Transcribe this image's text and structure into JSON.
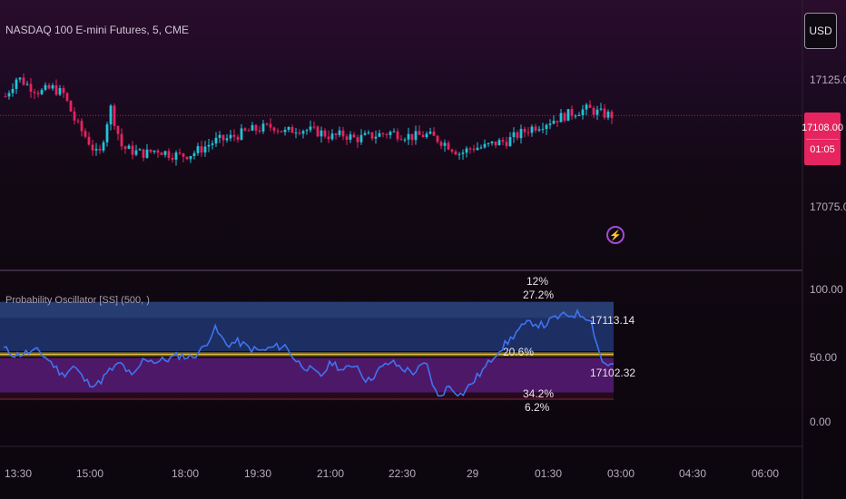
{
  "header": {
    "symbol": "NASDAQ 100 E-mini Futures, 5, CME",
    "currency_button": "USD"
  },
  "price_scale": {
    "labels": [
      "17125.00",
      "17075.00"
    ],
    "last_price": "17108.00",
    "countdown": "01:05"
  },
  "indicator": {
    "title": "Probability Oscillator [SS] (500, )",
    "scale_labels": [
      "100.00",
      "50.00",
      "0.00"
    ],
    "annotations": {
      "top_pct_1": "12%",
      "top_pct_2": "27.2%",
      "mid_pct": "20.6%",
      "upper_price": "17113.14",
      "lower_price": "17102.32",
      "bottom_pct_1": "34.2%",
      "bottom_pct_2": "6.2%"
    }
  },
  "time_axis": [
    "13:30",
    "15:00",
    "18:00",
    "19:30",
    "21:00",
    "22:30",
    "29",
    "01:30",
    "03:00",
    "04:30",
    "06:00"
  ],
  "colors": {
    "up_candle": "#22c3d8",
    "down_candle": "#e6245f",
    "oscillator_line": "#3f73f0",
    "upper_zone": "#2a4fa8",
    "lower_zone": "#6a1f8e",
    "midline": "#e2c247",
    "accent": "#a24bd6"
  },
  "icons": {
    "flash": "lightning-icon"
  },
  "chart_data": {
    "type": "candlestick",
    "price_range": [
      17062,
      17141
    ],
    "last_price": 17108,
    "close_series": [
      17117,
      17126,
      17122,
      17119,
      17121,
      17118,
      17105,
      17097,
      17088,
      17112,
      17093,
      17091,
      17090,
      17092,
      17090,
      17089,
      17090,
      17093,
      17096,
      17097,
      17099,
      17101,
      17102,
      17103,
      17100,
      17102,
      17101,
      17100,
      17098,
      17099,
      17097,
      17098,
      17099,
      17100,
      17099,
      17098,
      17099,
      17097,
      17094,
      17090,
      17093,
      17093,
      17095,
      17096,
      17099,
      17102,
      17104,
      17106,
      17108,
      17110,
      17111,
      17109,
      17108
    ],
    "oscillator": {
      "range": [
        0,
        100
      ],
      "upper_zone": [
        53,
        90
      ],
      "lower_zone": [
        22,
        48
      ],
      "midline": 50,
      "series": [
        55,
        50,
        52,
        53,
        45,
        35,
        42,
        30,
        28,
        38,
        44,
        33,
        48,
        45,
        47,
        50,
        48,
        55,
        70,
        58,
        60,
        55,
        53,
        56,
        57,
        45,
        40,
        34,
        45,
        38,
        44,
        30,
        39,
        45,
        40,
        37,
        44,
        18,
        27,
        20,
        30,
        40,
        52,
        60,
        70,
        75,
        72,
        78,
        80,
        81,
        78,
        45,
        42
      ]
    }
  }
}
